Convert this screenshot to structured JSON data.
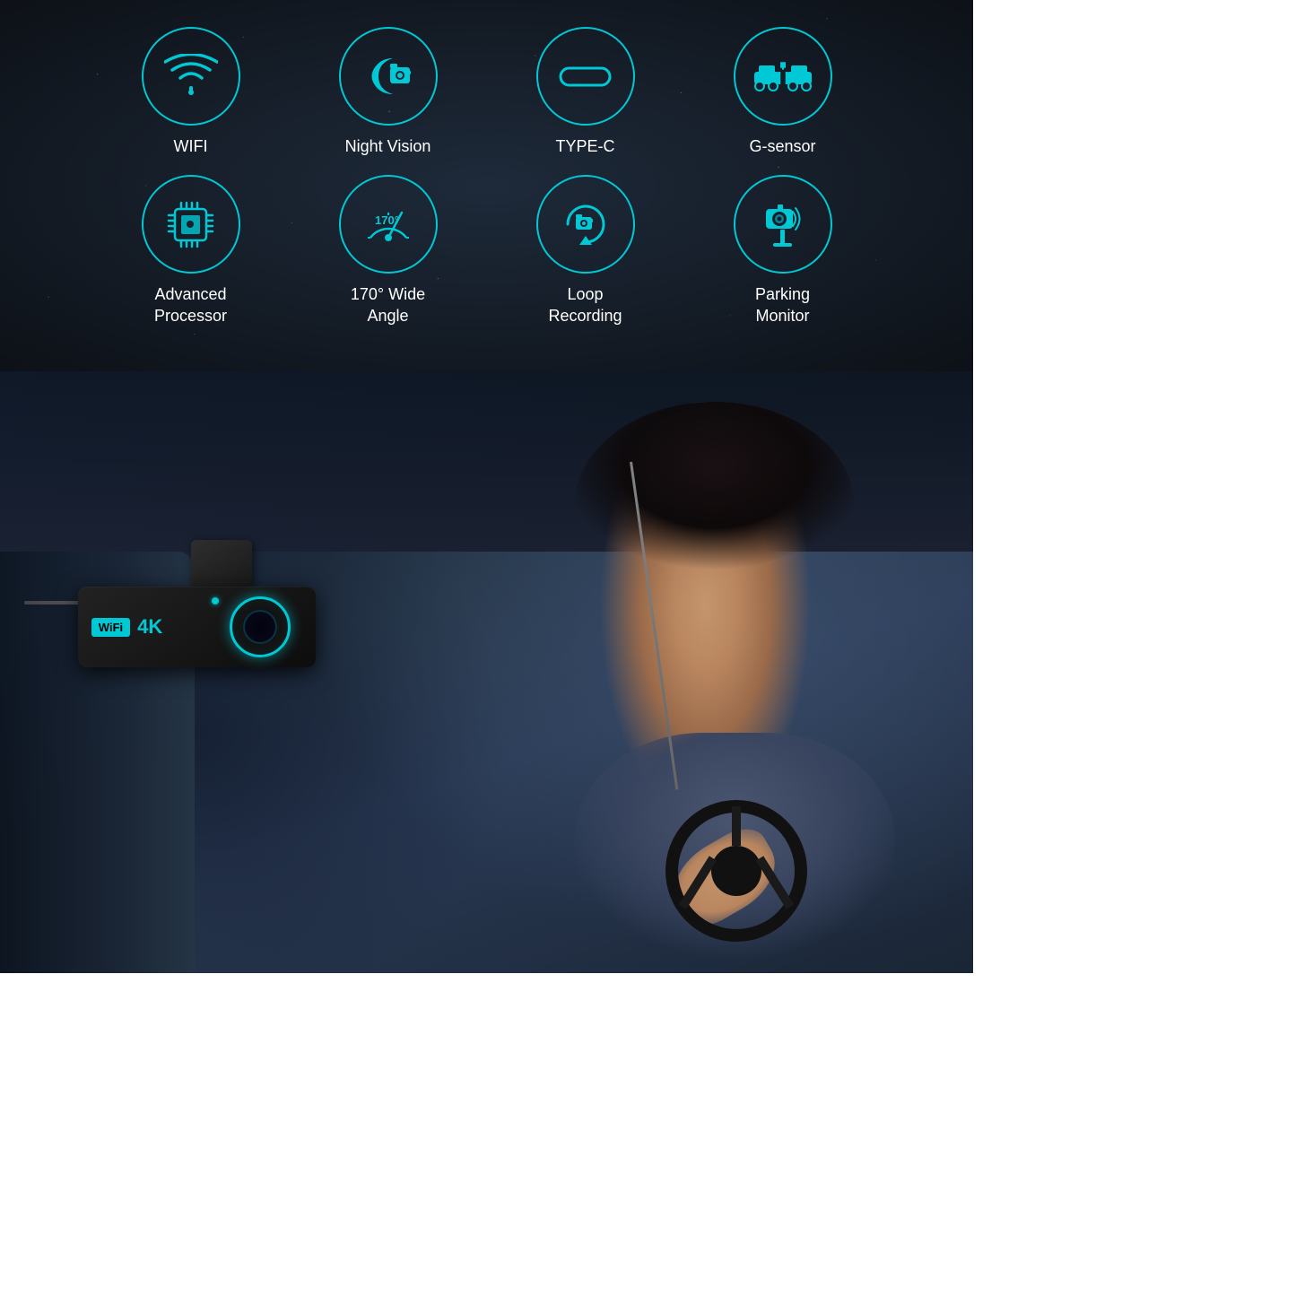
{
  "features_row1": [
    {
      "id": "wifi",
      "label": "WIFI",
      "icon": "wifi"
    },
    {
      "id": "night-vision",
      "label": "Night Vision",
      "icon": "night-vision"
    },
    {
      "id": "type-c",
      "label": "TYPE-C",
      "icon": "type-c"
    },
    {
      "id": "g-sensor",
      "label": "G-sensor",
      "icon": "g-sensor"
    }
  ],
  "features_row2": [
    {
      "id": "advanced-processor",
      "label": "Advanced\nProcessor",
      "icon": "processor"
    },
    {
      "id": "wide-angle",
      "label": "170° Wide\nAngle",
      "icon": "wide-angle"
    },
    {
      "id": "loop-recording",
      "label": "Loop\nRecording",
      "icon": "loop-recording"
    },
    {
      "id": "parking-monitor",
      "label": "Parking\nMonitor",
      "icon": "parking-monitor"
    }
  ],
  "dashcam": {
    "wifi_label": "WiFi",
    "resolution_label": "4K"
  },
  "colors": {
    "accent": "#00c8d4",
    "bg_dark": "#1a1f2e",
    "text_white": "#ffffff"
  }
}
